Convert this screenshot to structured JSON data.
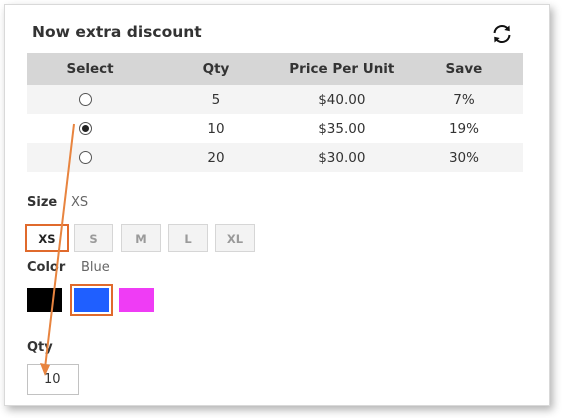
{
  "title": "Now extra discount",
  "table": {
    "headers": [
      "Select",
      "Qty",
      "Price Per Unit",
      "Save"
    ],
    "rows": [
      {
        "selected": false,
        "qty": "5",
        "price": "$40.00",
        "save": "7%"
      },
      {
        "selected": true,
        "qty": "10",
        "price": "$35.00",
        "save": "19%"
      },
      {
        "selected": false,
        "qty": "20",
        "price": "$30.00",
        "save": "30%"
      }
    ]
  },
  "size": {
    "label": "Size",
    "selected": "XS",
    "options": [
      "XS",
      "S",
      "M",
      "L",
      "XL"
    ]
  },
  "color": {
    "label": "Color",
    "selected": "Blue",
    "swatches": [
      {
        "name": "Black",
        "hex": "#000000"
      },
      {
        "name": "Blue",
        "hex": "#1f5fff"
      },
      {
        "name": "Magenta",
        "hex": "#ef3cf5"
      }
    ]
  },
  "qty": {
    "label": "Qty",
    "value": "10"
  },
  "colors": {
    "accent": "#e06a2c",
    "annotation_arrow": "#e8843f"
  },
  "icons": {
    "refresh": "refresh-icon"
  }
}
